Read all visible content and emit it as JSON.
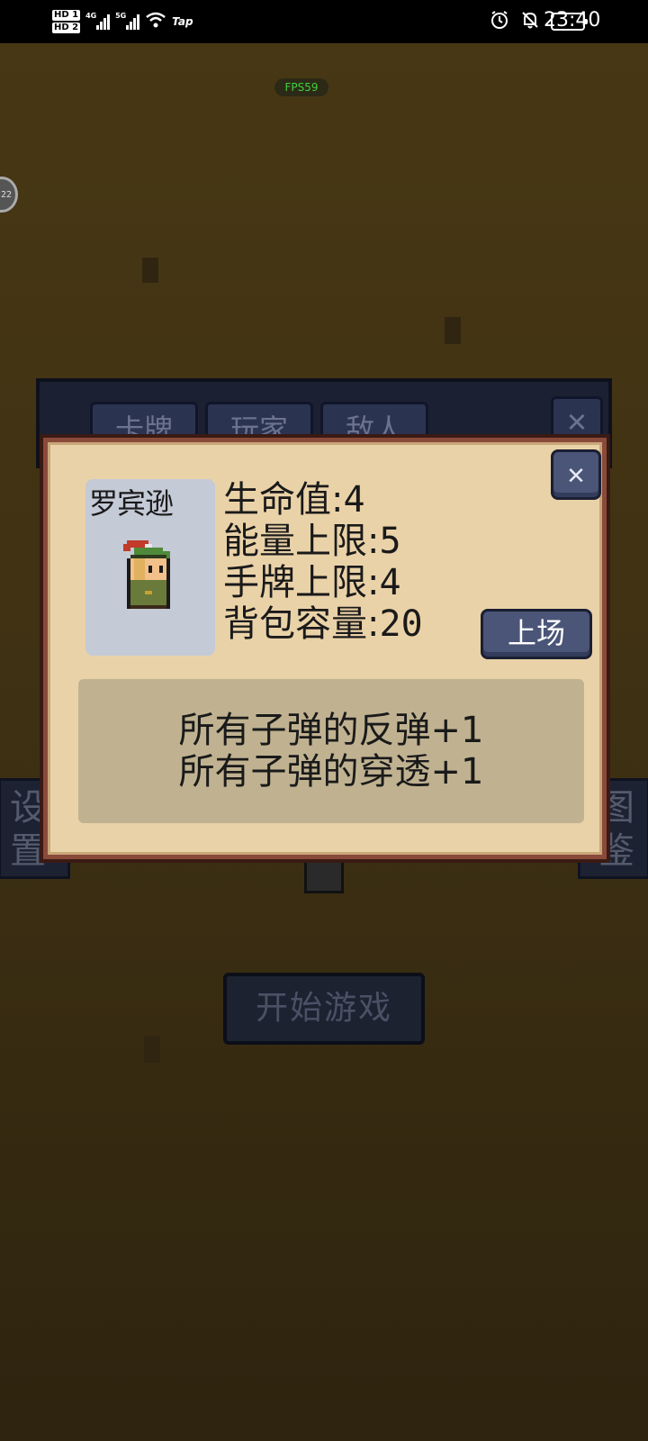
{
  "status_bar": {
    "hd1": "HD 1",
    "hd2": "HD 2",
    "net1": "4G",
    "net2": "5G",
    "tap_label": "Tap",
    "time": "23:40",
    "icons": [
      "alarm-icon",
      "bell-off-icon",
      "battery-icon"
    ]
  },
  "hud": {
    "fps": "FPS59",
    "bubble": "22"
  },
  "background": {
    "tabs": [
      "卡牌",
      "玩家",
      "敌人"
    ],
    "close_glyph": "✕",
    "left_button": "设\n置",
    "right_button": "图\n鉴",
    "start_button": "开始游戏"
  },
  "dialog": {
    "character_name": "罗宾逊",
    "stats": [
      {
        "label": "生命值:",
        "value": "4"
      },
      {
        "label": "能量上限:",
        "value": "5"
      },
      {
        "label": "手牌上限:",
        "value": "4"
      },
      {
        "label": "背包容量:",
        "value": "20"
      }
    ],
    "deploy_button": "上场",
    "close_glyph": "✕",
    "description": [
      "所有子弹的反弹+1",
      "所有子弹的穿透+1"
    ]
  },
  "colors": {
    "background": "#3a2d10",
    "dialog_bg": "#ead2a8",
    "dialog_border": "#8a4a3a",
    "button_blue": "#4a5577",
    "desc_box": "#c0b291",
    "fps_green": "#3fd03f"
  }
}
